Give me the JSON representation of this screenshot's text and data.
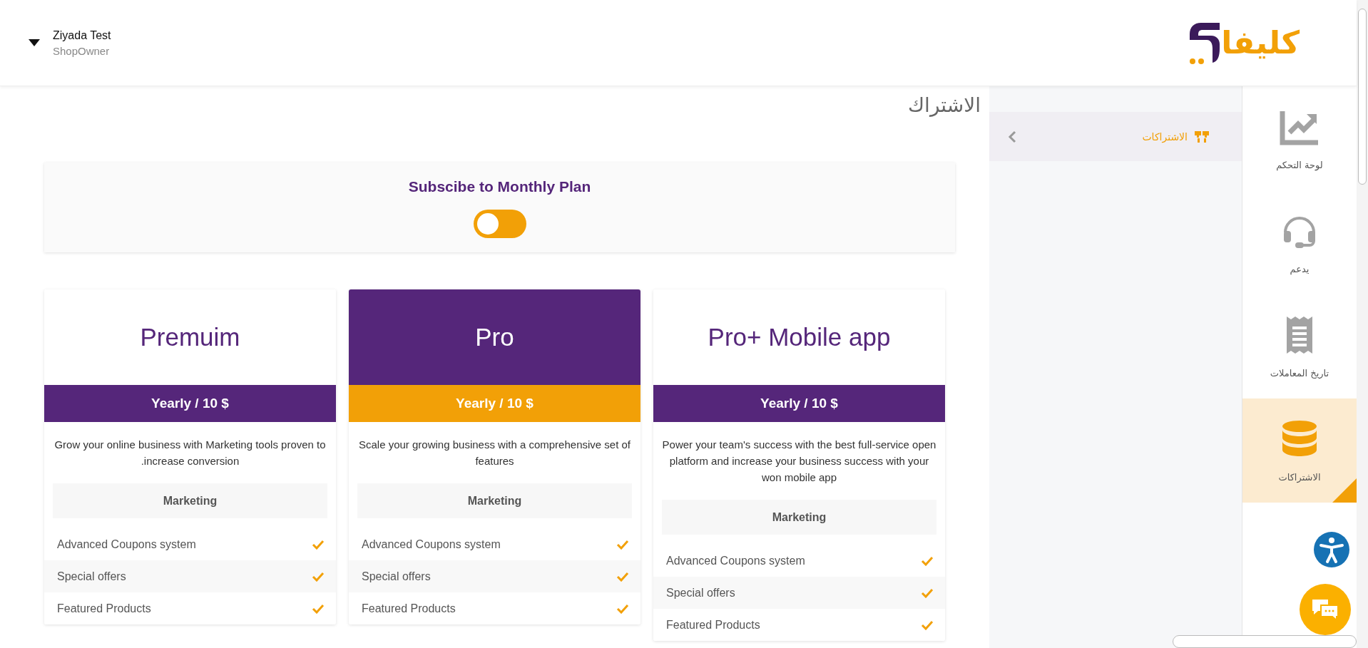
{
  "header": {
    "user_name": "Ziyada Test",
    "user_role": "ShopOwner",
    "logo_text": "كليفا"
  },
  "page_title": "الاشتراك",
  "submenu": {
    "items": [
      {
        "label": "الاشتراكات",
        "selected": true
      }
    ]
  },
  "sidebar": {
    "items": [
      {
        "label": "لوحة التحكم",
        "kind": "chart",
        "selected": false
      },
      {
        "label": "يدعم",
        "kind": "headset",
        "selected": false
      },
      {
        "label": "تاريخ المعاملات",
        "kind": "receipt",
        "selected": false
      },
      {
        "label": "الاشتراكات",
        "kind": "database",
        "selected": true
      }
    ]
  },
  "monthly_toggle": {
    "label": "Subscibe to Monthly Plan",
    "on": false
  },
  "plans": [
    {
      "name": "Premuim",
      "price": "Yearly / 10 $",
      "featured": false,
      "description": "Grow your online business with Marketing tools proven to .increase conversion",
      "section": "Marketing",
      "features": [
        {
          "label": "Advanced Coupons system",
          "checked": true
        },
        {
          "label": "Special offers",
          "checked": true
        },
        {
          "label": "Featured Products",
          "checked": true
        }
      ]
    },
    {
      "name": "Pro",
      "price": "Yearly / 10 $",
      "featured": true,
      "description": "Scale your growing business with a comprehensive set of features",
      "section": "Marketing",
      "features": [
        {
          "label": "Advanced Coupons system",
          "checked": true
        },
        {
          "label": "Special offers",
          "checked": true
        },
        {
          "label": "Featured Products",
          "checked": true
        }
      ]
    },
    {
      "name": "Pro+ Mobile app",
      "price": "Yearly / 10 $",
      "featured": false,
      "description": "Power your team's success with the best full-service open platform and increase your business success with your won mobile app",
      "section": "Marketing",
      "features": [
        {
          "label": "Advanced Coupons system",
          "checked": true
        },
        {
          "label": "Special offers",
          "checked": true
        },
        {
          "label": "Featured Products",
          "checked": true
        }
      ]
    }
  ]
}
